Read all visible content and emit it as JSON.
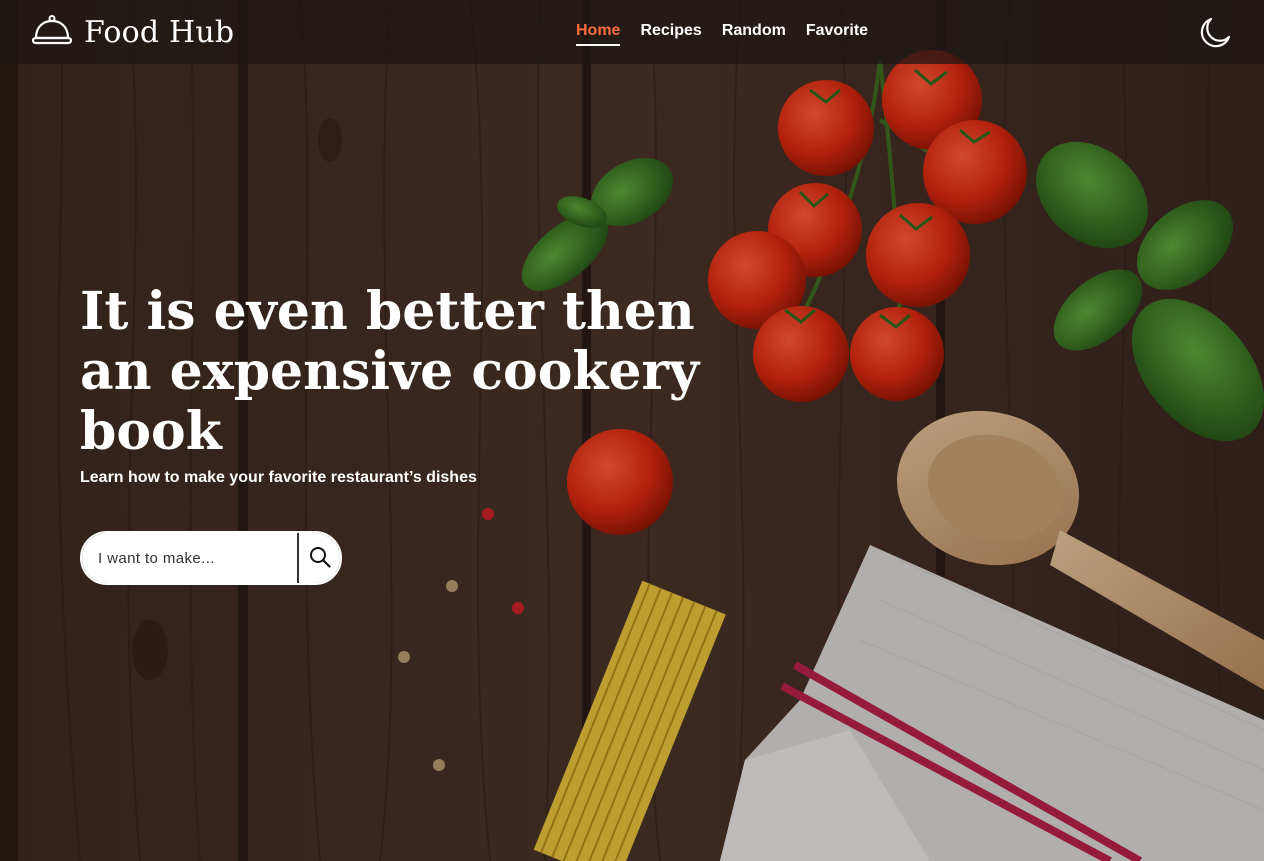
{
  "brand": {
    "name": "Food Hub",
    "logo_icon": "cloche-icon"
  },
  "nav": {
    "links": [
      {
        "label": "Home",
        "active": true
      },
      {
        "label": "Recipes",
        "active": false
      },
      {
        "label": "Random",
        "active": false
      },
      {
        "label": "Favorite",
        "active": false
      }
    ],
    "theme_toggle_icon": "moon-icon"
  },
  "hero": {
    "headline": "It is even better then an expensive cookery book",
    "subtitle": "Learn how to make your favorite restaurant’s dishes",
    "search": {
      "placeholder": "I want to make...",
      "value": "",
      "button_icon": "search-icon"
    },
    "background_image": "food-table-photo"
  },
  "colors": {
    "accent": "#ff6a3d",
    "navbar_bg": "#1c1614",
    "text": "#ffffff"
  }
}
